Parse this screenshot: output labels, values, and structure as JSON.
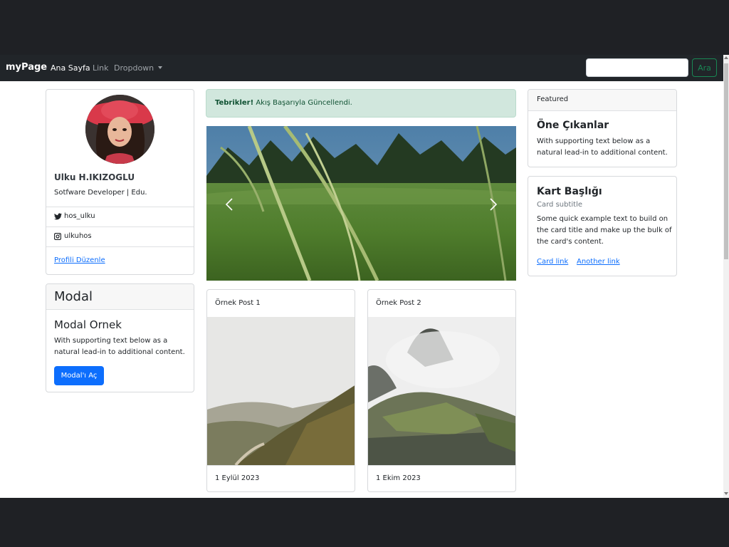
{
  "navbar": {
    "brand": "myPage",
    "links": [
      "Ana Sayfa",
      "Link",
      "Dropdown"
    ],
    "search": {
      "placeholder": "",
      "button": "Ara"
    }
  },
  "profile": {
    "name": "Ulku H.IKIZOGLU",
    "title": "Sotfware Developer | Edu.",
    "twitter": "hos_ulku",
    "instagram": "ulkuhos",
    "edit_link": "Profili Düzenle"
  },
  "modal_card": {
    "header": "Modal",
    "title": "Modal Ornek",
    "text_line1": "With supporting text below as a",
    "text_line2": "natural lead-in to additional content.",
    "button": "Modal'ı Aç"
  },
  "alert": {
    "strong": "Tebrikler!",
    "text": " Akış Başarıyla Güncellendi."
  },
  "posts": [
    {
      "header": "Örnek Post 1",
      "date": "1 Eylül 2023"
    },
    {
      "header": "Örnek Post 2",
      "date": "1 Ekim 2023"
    }
  ],
  "featured": {
    "header": "Featured",
    "title": "Öne Çıkanlar",
    "text_line1": "With supporting text below as a",
    "text_line2": "natural lead-in to additional content."
  },
  "kart": {
    "title": "Kart Başlığı",
    "subtitle": "Card subtitle",
    "text_line1": "Some quick example text to build on",
    "text_line2": "the card title and make up the bulk of",
    "text_line3": "the card's content.",
    "link1": "Card link",
    "link2": "Another link"
  },
  "colors": {
    "navbar": "#212529",
    "primary": "#0d6efd",
    "success": "#198754",
    "alert_bg": "#d1e7dd"
  }
}
